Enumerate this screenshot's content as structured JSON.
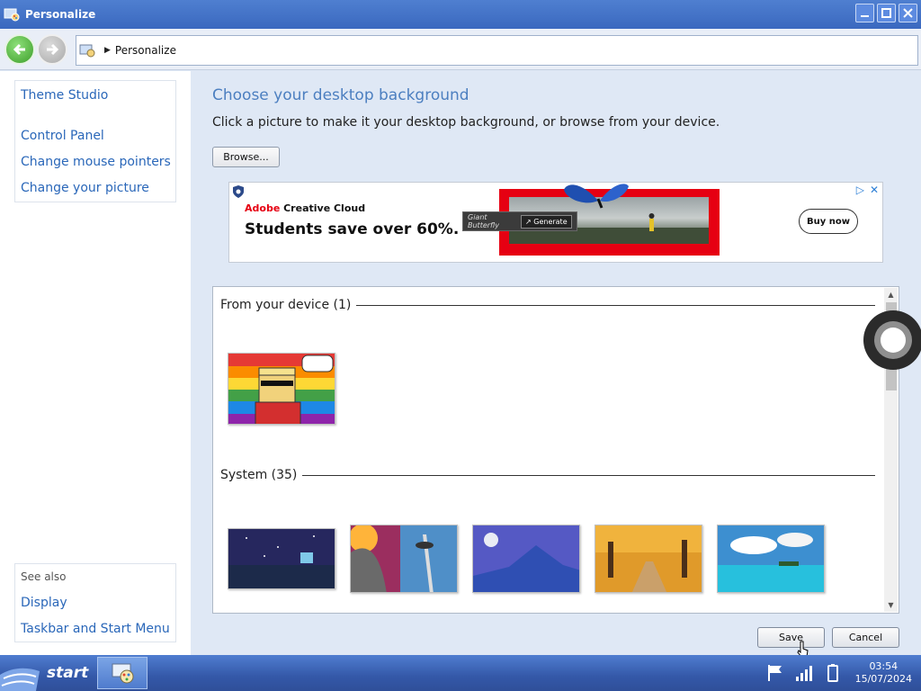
{
  "window": {
    "title": "Personalize",
    "address": "Personalize"
  },
  "sidebar": {
    "top_links": [
      "Theme Studio",
      "Control Panel",
      "Change mouse pointers",
      "Change your picture"
    ],
    "see_also_label": "See also",
    "bottom_links": [
      "Display",
      "Taskbar and Start Menu"
    ]
  },
  "main": {
    "heading": "Choose your desktop background",
    "description": "Click a picture to make it your desktop background, or browse from your device.",
    "browse_label": "Browse..."
  },
  "ad": {
    "brand_prefix": "Adobe",
    "brand_suffix": " Creative Cloud",
    "headline": "Students save over 60%.",
    "tag_name": "Giant Butterfly",
    "tag_action": "Generate",
    "cta": "Buy now"
  },
  "gallery": {
    "groups": [
      {
        "label": "From your device (1)",
        "thumbs": [
          "cartoon-rainbow"
        ]
      },
      {
        "label": "System (35)",
        "thumbs": [
          "night-lake",
          "space-needle",
          "mountain-moon",
          "autumn-path",
          "tropical-beach"
        ]
      }
    ]
  },
  "buttons": {
    "save": "Save",
    "cancel": "Cancel"
  },
  "taskbar": {
    "start_label": "start",
    "time": "03:54",
    "date": "15/07/2024"
  },
  "colors": {
    "titlebar": "#3a68bf",
    "link": "#2a67b9",
    "heading": "#4c7fc0",
    "ad_red": "#e60012"
  }
}
